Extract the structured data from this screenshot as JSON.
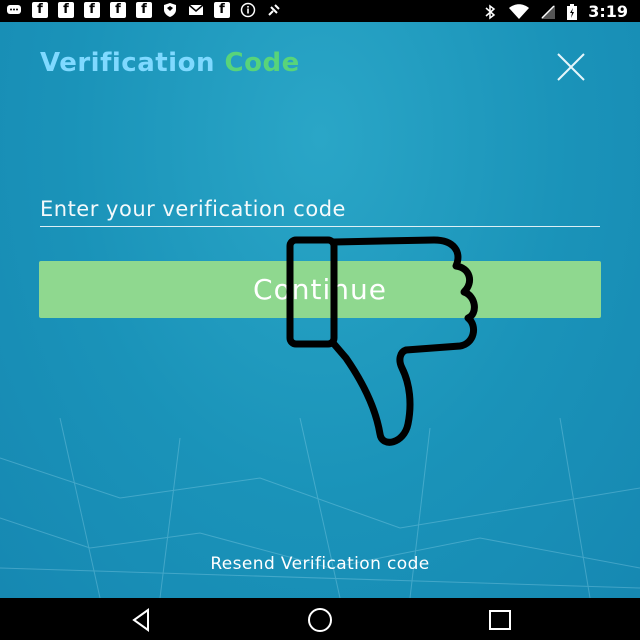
{
  "status_bar": {
    "time": "3:19",
    "left_icons": [
      "chat-icon",
      "facebook-icon",
      "facebook-icon",
      "facebook-icon",
      "facebook-icon",
      "facebook-icon",
      "shield-icon",
      "mail-icon",
      "facebook-icon",
      "info-icon",
      "satellite-icon"
    ],
    "right_icons": [
      "bluetooth-icon",
      "wifi-icon",
      "signal-icon",
      "battery-icon"
    ]
  },
  "header": {
    "title_part1": "Verification",
    "title_part2": "Code",
    "colors": {
      "part1": "#7fd9ff",
      "part2": "#58d47a"
    }
  },
  "form": {
    "code_placeholder": "Enter your verification code",
    "code_value": "",
    "continue_label": "Continue",
    "continue_color": "#8fd88f"
  },
  "footer": {
    "resend_label": "Resend Verification code"
  },
  "overlay": {
    "icon": "thumbs-down-icon"
  },
  "nav": {
    "buttons": [
      "back-icon",
      "home-icon",
      "recents-icon"
    ]
  }
}
